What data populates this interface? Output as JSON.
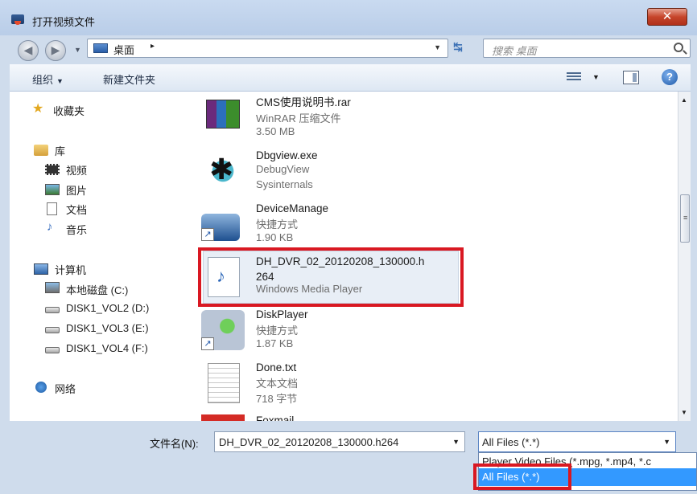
{
  "window": {
    "title": "打开视频文件",
    "close_glyph": "✕"
  },
  "address_bar": {
    "path": "桌面",
    "separator": "▸"
  },
  "search": {
    "placeholder": "搜索 桌面"
  },
  "toolbar": {
    "organize": "组织",
    "new_folder": "新建文件夹",
    "help": "?"
  },
  "sidebar": {
    "favorites": "收藏夹",
    "libraries": "库",
    "library_items": [
      "视频",
      "图片",
      "文档",
      "音乐"
    ],
    "computer": "计算机",
    "drives": [
      "本地磁盘 (C:)",
      "DISK1_VOL2 (D:)",
      "DISK1_VOL3 (E:)",
      "DISK1_VOL4 (F:)"
    ],
    "network": "网络"
  },
  "files": [
    {
      "name": "CMS使用说明书.rar",
      "line1": "WinRAR 压缩文件",
      "line2": "3.50 MB",
      "icon": "winrar-icon"
    },
    {
      "name": "Dbgview.exe",
      "line1": "DebugView",
      "line2": "Sysinternals",
      "icon": "bug-icon"
    },
    {
      "name": "DeviceManage",
      "line1": "快捷方式",
      "line2": "1.90 KB",
      "icon": "shortcut-icon"
    },
    {
      "name": "DH_DVR_02_20120208_130000.h\n264",
      "line1": "Windows Media Player",
      "line2": "",
      "icon": "media-file-icon",
      "selected": true
    },
    {
      "name": "DiskPlayer",
      "line1": "快捷方式",
      "line2": "1.87 KB",
      "icon": "player-shortcut-icon"
    },
    {
      "name": "Done.txt",
      "line1": "文本文档",
      "line2": "718 字节",
      "icon": "text-file-icon"
    },
    {
      "name": "Foxmail",
      "line1": "",
      "line2": "",
      "icon": "foxmail-icon"
    }
  ],
  "bottom": {
    "filename_label": "文件名(N):",
    "filename_value": "DH_DVR_02_20120208_130000.h264",
    "filetype_selected": "All Files (*.*)",
    "filetype_options": [
      "Player Video Files (*.mpg, *.mp4, *.c",
      "All Files (*.*)"
    ]
  },
  "colors": {
    "highlight_frame": "#d91822",
    "dropdown_selection": "#3399ff"
  }
}
